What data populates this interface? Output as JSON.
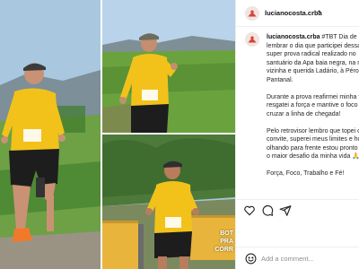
{
  "post": {
    "username": "lucianocosta.crba",
    "separator": "•",
    "caption_lines": [
      [
        "#TBT Dia de",
        "lembrar o dia que participei dessa",
        "super prova radical realizado no",
        "santuário da Apa baia negra, na minha",
        "vizinha e querida Ladário, à Pérola do",
        "Pantanal."
      ],
      [
        "Durante a prova reafirmei minha força",
        "resgatei a força e mantive o foco para",
        "cruzar a linha de chegada!"
      ],
      [
        "Pelo retrovisor lembro que topei o",
        "convite, superei meus limites e hoje",
        "olhando para frente estou pronto para",
        "o maior desafio da minha vida 🙏"
      ],
      [
        "Força, Foco, Trabalho e Fé!"
      ]
    ],
    "overlay_text": [
      "BOT",
      "PRA",
      "CORR"
    ],
    "bib_number": "413"
  },
  "actions": {
    "like_icon": "heart-icon",
    "comment_icon": "comment-icon",
    "share_icon": "share-icon"
  },
  "comment": {
    "placeholder": "Add a comment...",
    "emoji_icon": "emoji-icon"
  },
  "colors": {
    "shirt": "#f2c21b",
    "grass": "#5f9a3a",
    "sky": "#9ec3de",
    "border": "#efefef"
  }
}
